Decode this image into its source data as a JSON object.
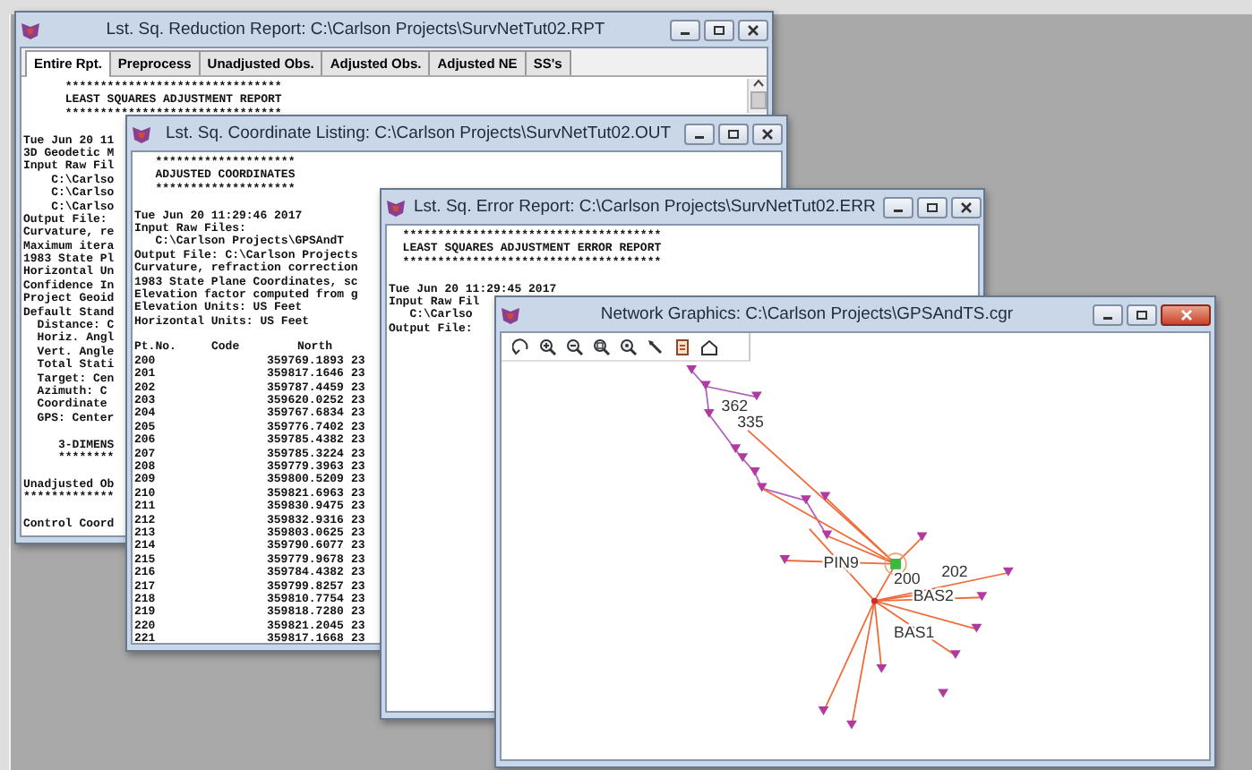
{
  "windows": [
    {
      "kind": "report",
      "active": false,
      "title": "Lst. Sq. Reduction Report: C:\\Carlson Projects\\SurvNetTut02.RPT",
      "tabs": [
        {
          "label": "Entire Rpt.",
          "selected": true
        },
        {
          "label": "Preprocess",
          "selected": false
        },
        {
          "label": "Unadjusted Obs.",
          "selected": false
        },
        {
          "label": "Adjusted Obs.",
          "selected": false
        },
        {
          "label": "Adjusted NE",
          "selected": false
        },
        {
          "label": "SS's",
          "selected": false
        }
      ],
      "blocks": [
        [
          "      *******************************",
          "      LEAST SQUARES ADJUSTMENT REPORT",
          "      *******************************"
        ],
        [
          "Tue Jun 20 11",
          "3D Geodetic M",
          "Input Raw Fil",
          "    C:\\Carlso",
          "    C:\\Carlso",
          "    C:\\Carlso",
          "Output File: ",
          "Curvature, re",
          "Maximum itera",
          "1983 State Pl",
          "Horizontal Un",
          "Confidence In",
          "Project Geoid",
          "Default Stand",
          "  Distance: C",
          "  Horiz. Angl",
          "  Vert. Angle",
          "  Total Stati",
          "  Target: Cen",
          "  Azimuth: C",
          "  Coordinate ",
          "  GPS: Center"
        ],
        [
          "     3-DIMENS",
          "     ********"
        ],
        [
          "Unadjusted Ob",
          "*************"
        ],
        [
          "Control Coord"
        ]
      ]
    },
    {
      "kind": "listing",
      "active": false,
      "title": "Lst. Sq. Coordinate Listing: C:\\Carlson Projects\\SurvNetTut02.OUT",
      "blocks": [
        [
          "   ********************",
          "   ADJUSTED COORDINATES",
          "   ********************"
        ],
        [
          "Tue Jun 20 11:29:46 2017",
          "Input Raw Files:",
          "   C:\\Carlson Projects\\GPSAndT",
          "Output File: C:\\Carlson Projects",
          "Curvature, refraction correction",
          "1983 State Plane Coordinates, sc",
          "Elevation factor computed from g",
          "Elevation Units: US Feet",
          "Horizontal Units: US Feet"
        ]
      ],
      "table": {
        "columns": [
          "Pt.No.",
          "Code",
          "North"
        ],
        "rows": [
          {
            "pt": "200",
            "north": "359769.1893",
            "east": "23"
          },
          {
            "pt": "201",
            "north": "359817.1646",
            "east": "23"
          },
          {
            "pt": "202",
            "north": "359787.4459",
            "east": "23"
          },
          {
            "pt": "203",
            "north": "359620.0252",
            "east": "23"
          },
          {
            "pt": "204",
            "north": "359767.6834",
            "east": "23"
          },
          {
            "pt": "205",
            "north": "359776.7402",
            "east": "23"
          },
          {
            "pt": "206",
            "north": "359785.4382",
            "east": "23"
          },
          {
            "pt": "207",
            "north": "359785.3224",
            "east": "23"
          },
          {
            "pt": "208",
            "north": "359779.3963",
            "east": "23"
          },
          {
            "pt": "209",
            "north": "359800.5209",
            "east": "23"
          },
          {
            "pt": "210",
            "north": "359821.6963",
            "east": "23"
          },
          {
            "pt": "211",
            "north": "359830.9475",
            "east": "23"
          },
          {
            "pt": "212",
            "north": "359832.9316",
            "east": "23"
          },
          {
            "pt": "213",
            "north": "359803.0625",
            "east": "23"
          },
          {
            "pt": "214",
            "north": "359790.6077",
            "east": "23"
          },
          {
            "pt": "215",
            "north": "359779.9678",
            "east": "23"
          },
          {
            "pt": "216",
            "north": "359784.4382",
            "east": "23"
          },
          {
            "pt": "217",
            "north": "359799.8257",
            "east": "23"
          },
          {
            "pt": "218",
            "north": "359810.7754",
            "east": "23"
          },
          {
            "pt": "219",
            "north": "359818.7280",
            "east": "23"
          },
          {
            "pt": "220",
            "north": "359821.2045",
            "east": "23"
          },
          {
            "pt": "221",
            "north": "359817.1668",
            "east": "23"
          }
        ]
      }
    },
    {
      "kind": "report",
      "active": false,
      "title": "Lst. Sq. Error Report: C:\\Carlson Projects\\SurvNetTut02.ERR",
      "blocks": [
        [
          "  *************************************",
          "  LEAST SQUARES ADJUSTMENT ERROR REPORT",
          "  *************************************"
        ],
        [
          "Tue Jun 20 11:29:45 2017",
          "Input Raw Fil",
          "   C:\\Carlso",
          "Output File: "
        ]
      ]
    },
    {
      "kind": "graphics",
      "active": true,
      "title": "Network Graphics: C:\\Carlson Projects\\GPSAndTS.cgr",
      "labels": [
        "362",
        "335",
        "PIN9",
        "200",
        "202",
        "BAS2",
        "BAS1"
      ]
    }
  ]
}
